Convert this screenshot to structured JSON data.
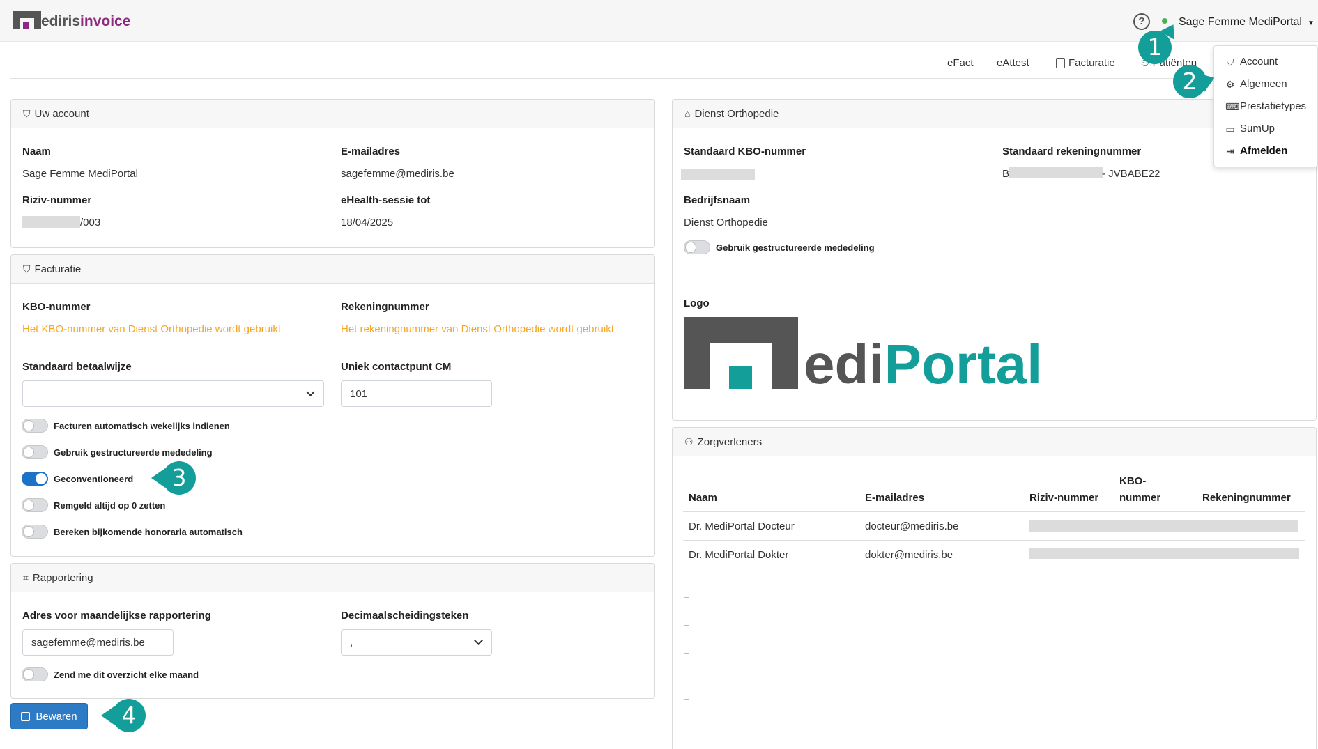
{
  "app": {
    "logo_prefix": "M",
    "logo_name": "ediris",
    "logo_suffix": "invoice",
    "user_name": "Sage Femme MediPortal"
  },
  "nav": {
    "items": [
      {
        "label": "eFact"
      },
      {
        "label": "eAttest"
      },
      {
        "label": "Facturatie",
        "icon": "document-icon"
      },
      {
        "label": "Patiënten",
        "icon": "users-icon"
      }
    ]
  },
  "dropdown": {
    "items": [
      {
        "label": "Account",
        "icon": "shield-icon"
      },
      {
        "label": "Algemeen",
        "icon": "gear-icon"
      },
      {
        "label": "Prestatietypes",
        "icon": "keyboard-icon"
      },
      {
        "label": "SumUp",
        "icon": "card-icon"
      },
      {
        "label": "Afmelden",
        "icon": "logout-icon"
      }
    ]
  },
  "account": {
    "title": "Uw account",
    "naam_label": "Naam",
    "naam_value": "Sage Femme MediPortal",
    "email_label": "E-mailadres",
    "email_value": "sagefemme@mediris.be",
    "riziv_label": "Riziv-nummer",
    "riziv_suffix": "/003",
    "ehealth_label": "eHealth-sessie tot",
    "ehealth_value": "18/04/2025"
  },
  "facturatie": {
    "title": "Facturatie",
    "kbo_label": "KBO-nummer",
    "kbo_value": "Het KBO-nummer van Dienst Orthopedie wordt gebruikt",
    "rekening_label": "Rekeningnummer",
    "rekening_value": "Het rekeningnummer van Dienst Orthopedie wordt gebruikt",
    "betaalwijze_label": "Standaard betaalwijze",
    "betaalwijze_value": "",
    "contactpunt_label": "Uniek contactpunt CM",
    "contactpunt_value": "101",
    "toggles": [
      {
        "label": "Facturen automatisch wekelijks indienen",
        "on": false
      },
      {
        "label": "Gebruik gestructureerde mededeling",
        "on": false
      },
      {
        "label": "Geconventioneerd",
        "on": true
      },
      {
        "label": "Remgeld altijd op 0 zetten",
        "on": false
      },
      {
        "label": "Bereken bijkomende honoraria automatisch",
        "on": false
      }
    ]
  },
  "rapportering": {
    "title": "Rapportering",
    "adres_label": "Adres voor maandelijkse rapportering",
    "adres_value": "sagefemme@mediris.be",
    "decimaal_label": "Decimaalscheidingsteken",
    "decimaal_value": ",",
    "toggle_label": "Zend me dit overzicht elke maand"
  },
  "save_label": "Bewaren",
  "dienst": {
    "title": "Dienst Orthopedie",
    "kbo_label": "Standaard KBO-nummer",
    "rekening_label": "Standaard rekeningnummer",
    "rekening_prefix": "BE",
    "rekening_suffix": "- JVBABE22",
    "bedrijf_label": "Bedrijfsnaam",
    "bedrijf_value": "Dienst Orthopedie",
    "toggle_label": "Gebruik gestructureerde mededeling",
    "logo_label": "Logo",
    "logo_text_a": "edi",
    "logo_text_b": "Portal"
  },
  "zorgverleners": {
    "title": "Zorgverleners",
    "columns": [
      "Naam",
      "E-mailadres",
      "Riziv-nummer",
      "KBO-",
      "nummer",
      "Rekeningnummer"
    ],
    "rows": [
      {
        "naam": "Dr. MediPortal Docteur",
        "email": "docteur@mediris.be"
      },
      {
        "naam": "Dr. MediPortal Dokter",
        "email": "dokter@mediris.be"
      }
    ]
  },
  "callouts": [
    "1",
    "2",
    "3",
    "4"
  ],
  "colors": {
    "accent": "#149e9a",
    "brand": "#8b2a7e",
    "primary": "#2d7bc4",
    "warning": "#f5a623"
  }
}
